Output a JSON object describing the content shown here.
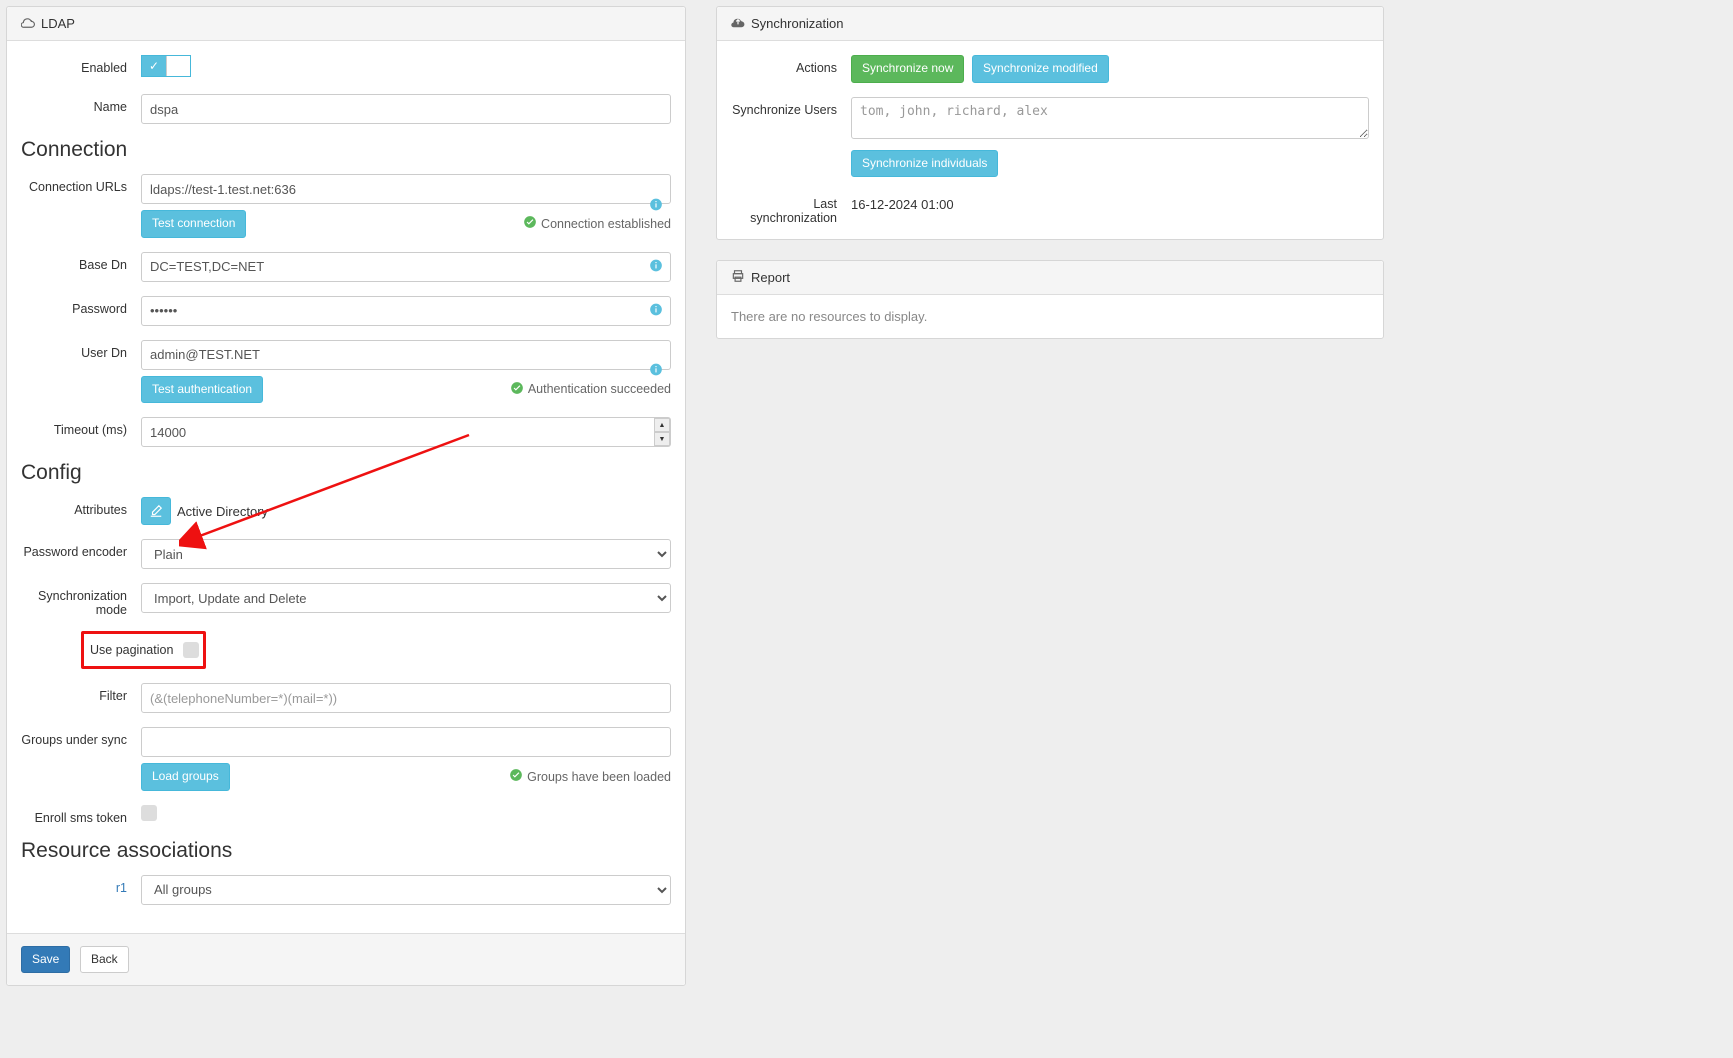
{
  "ldap": {
    "panel_title": "LDAP",
    "labels": {
      "enabled": "Enabled",
      "name": "Name",
      "connection": "Connection",
      "connection_urls": "Connection URLs",
      "test_connection": "Test connection",
      "connection_status": "Connection established",
      "base_dn": "Base Dn",
      "password": "Password",
      "user_dn": "User Dn",
      "test_auth": "Test authentication",
      "auth_status": "Authentication succeeded",
      "timeout": "Timeout (ms)",
      "config": "Config",
      "attributes": "Attributes",
      "attributes_value": "Active Directory",
      "password_encoder": "Password encoder",
      "sync_mode": "Synchronization mode",
      "use_pagination": "Use pagination",
      "filter": "Filter",
      "groups_under_sync": "Groups under sync",
      "load_groups": "Load groups",
      "groups_status": "Groups have been loaded",
      "enroll_sms": "Enroll sms token",
      "resource_assoc": "Resource associations",
      "r1": "r1",
      "save": "Save",
      "back": "Back"
    },
    "values": {
      "name": "dspa",
      "connection_url": "ldaps://test-1.test.net:636",
      "base_dn": "DC=TEST,DC=NET",
      "password": "••••••",
      "user_dn": "admin@TEST.NET",
      "timeout": "14000",
      "password_encoder": "Plain",
      "sync_mode": "Import, Update and Delete",
      "filter": "(&(telephoneNumber=*)(mail=*))",
      "groups_under_sync": "",
      "r1_select": "All groups"
    }
  },
  "sync": {
    "panel_title": "Synchronization",
    "labels": {
      "actions": "Actions",
      "sync_now": "Synchronize now",
      "sync_modified": "Synchronize modified",
      "sync_users": "Synchronize Users",
      "users_placeholder": "tom, john, richard, alex",
      "sync_individuals": "Synchronize individuals",
      "last_sync": "Last synchronization"
    },
    "values": {
      "last_sync": "16-12-2024 01:00"
    }
  },
  "report": {
    "panel_title": "Report",
    "empty": "There are no resources to display."
  }
}
